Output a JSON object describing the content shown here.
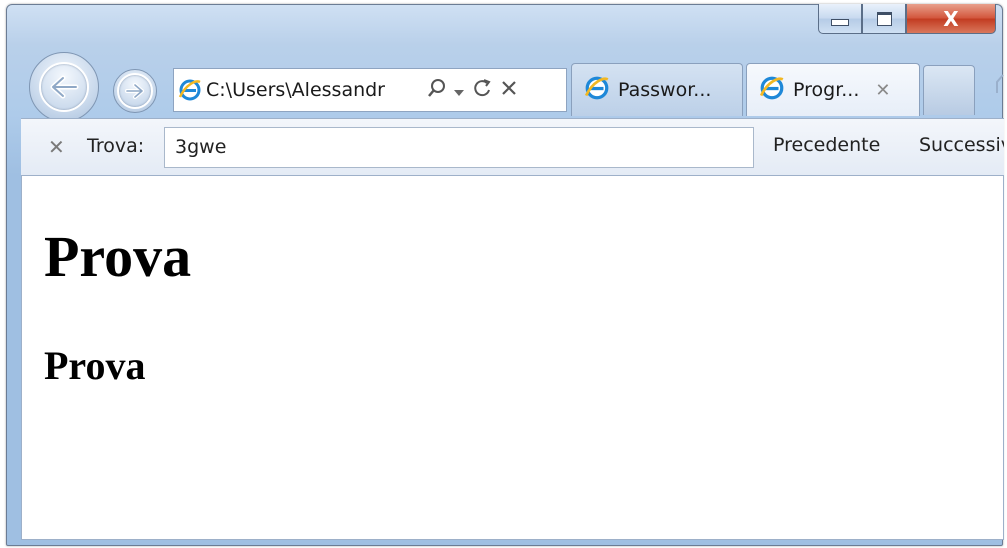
{
  "window": {
    "caption_close_glyph": "X"
  },
  "address_bar": {
    "url": "C:\\Users\\Alessandr"
  },
  "tabs": [
    {
      "label": "Passwor...",
      "icon": "ie-icon",
      "active": false
    },
    {
      "label": "Progr...",
      "icon": "ie-icon",
      "active": true,
      "close": "✕"
    }
  ],
  "find_bar": {
    "close_glyph": "✕",
    "label": "Trova:",
    "query": "3gwe",
    "previous": "Precedente",
    "next": "Successivo"
  },
  "page": {
    "heading1": "Prova",
    "heading2": "Prova"
  },
  "colors": {
    "frame": "#b9d0ea",
    "close_button": "#c23b20",
    "ie_logo": "#1e88d8"
  }
}
